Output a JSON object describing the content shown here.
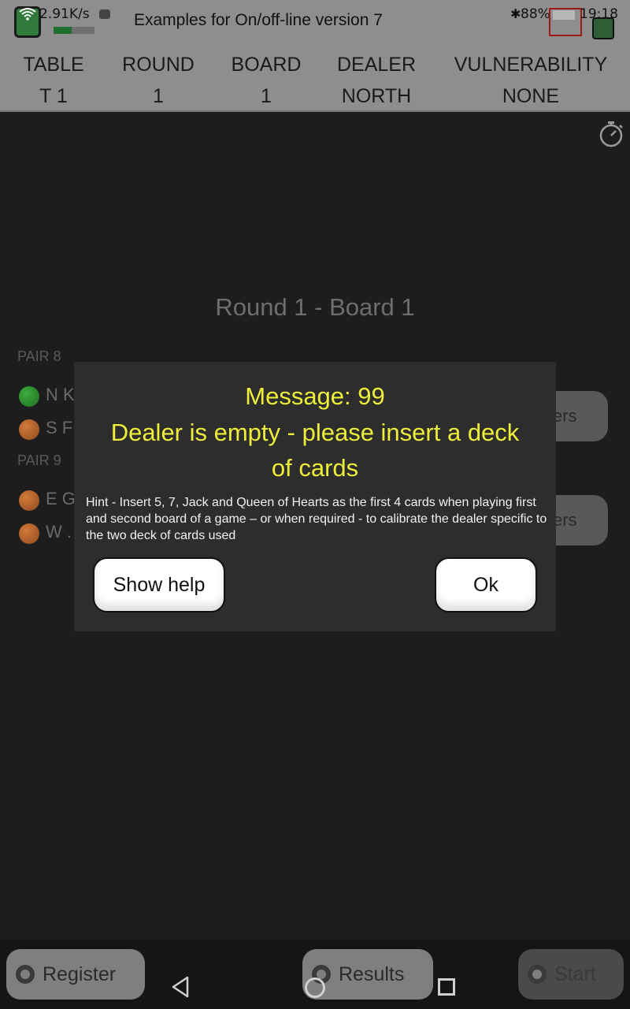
{
  "status": {
    "net_speed": "2.91K/s",
    "battery": "88%",
    "bt_glyph": "✱",
    "time": "19:18",
    "app_title": "Examples for On/off-line version 7",
    "progress_fraction": 0.45
  },
  "header": {
    "columns": [
      {
        "label": "TABLE",
        "value": "T 1"
      },
      {
        "label": "ROUND",
        "value": "1"
      },
      {
        "label": "BOARD",
        "value": "1"
      },
      {
        "label": "DEALER",
        "value": "NORTH"
      },
      {
        "label": "VULNERABILITY",
        "value": "NONE"
      }
    ]
  },
  "main": {
    "round_title": "Round 1 - Board 1",
    "pairs": [
      {
        "label": "PAIR 8",
        "players": [
          "N K",
          "S F"
        ],
        "button_fragment": "ers"
      },
      {
        "label": "PAIR 9",
        "players": [
          "E G",
          "W ."
        ],
        "button_fragment": "ers"
      }
    ]
  },
  "dialog": {
    "message_code": "Message: 99",
    "message_line1": "Dealer is empty - please insert a deck",
    "message_line2": "of cards",
    "hint": "Hint - Insert 5, 7, Jack and Queen of Hearts as the first 4 cards when playing first and second board of a game – or when required - to calibrate the dealer specific to the two deck of cards used",
    "show_help_label": "Show help",
    "ok_label": "Ok",
    "message_color": "#eeee3a"
  },
  "bottom": {
    "register_label": "Register",
    "results_label": "Results",
    "start_label": "Start"
  },
  "icons": {
    "stopwatch": "stopwatch-icon",
    "wifi": "wifi-icon",
    "back": "back-icon",
    "home": "home-icon",
    "recent": "recent-apps-icon"
  }
}
